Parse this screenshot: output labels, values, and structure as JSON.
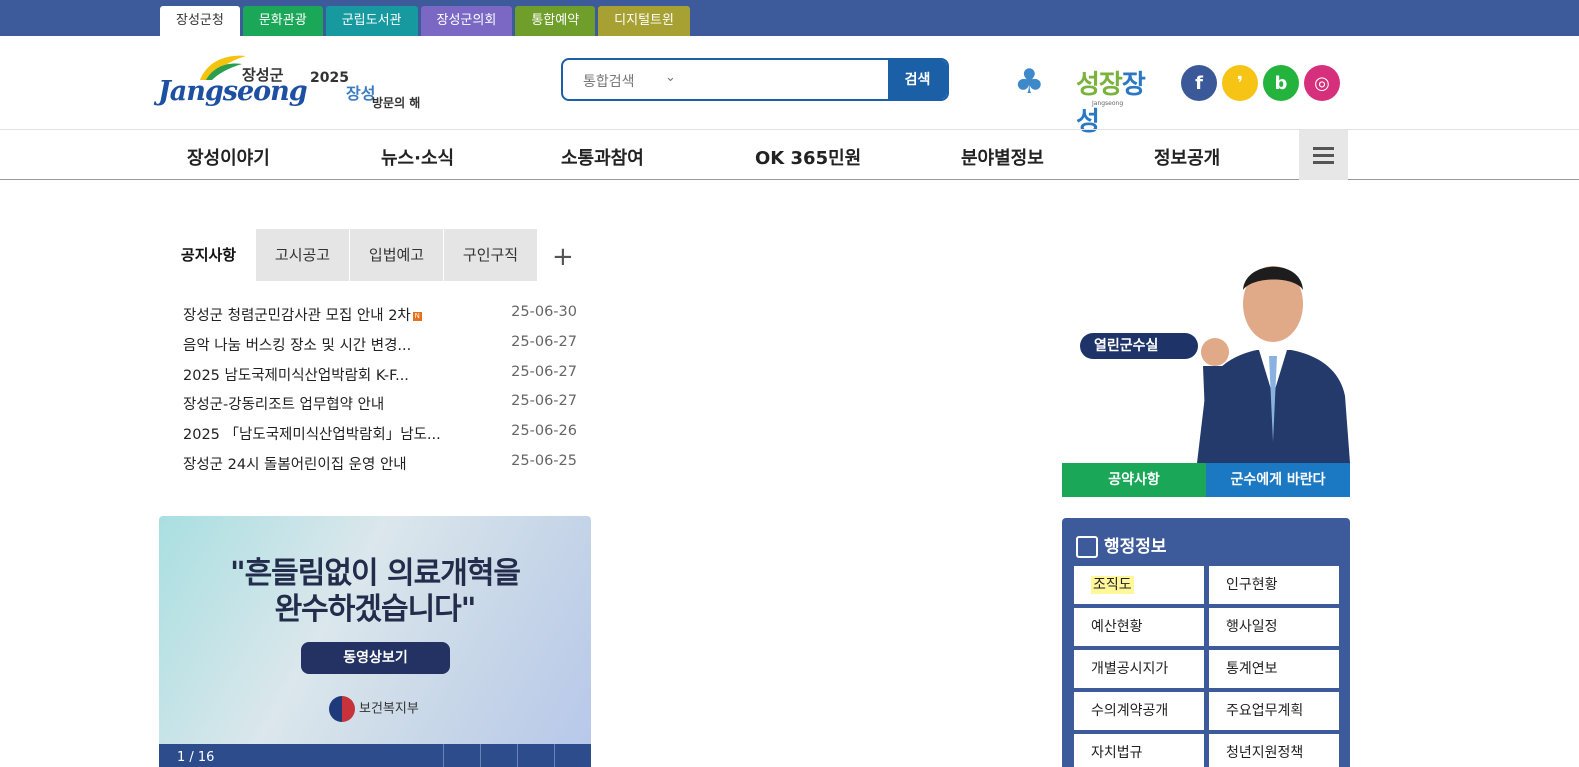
{
  "site_tabs": [
    {
      "label": "장성군청",
      "color": "#ffffff"
    },
    {
      "label": "문화관광",
      "color": "#1aa858"
    },
    {
      "label": "군립도서관",
      "color": "#169aa0"
    },
    {
      "label": "장성군의회",
      "color": "#7a68c4"
    },
    {
      "label": "통합예약",
      "color": "#6f9e2a"
    },
    {
      "label": "디지털트윈",
      "color": "#a7a133"
    }
  ],
  "header": {
    "logo_kor": "장성군",
    "logo_eng": "Jangseong",
    "visit_year": "2025",
    "visit_title": "장성",
    "visit_sub": "방문의 해",
    "search_select": "통합검색",
    "search_placeholder": "",
    "search_button": "검색",
    "brand_text_a": "성장",
    "brand_text_b": "장성",
    "brand_tiny": "Jangseong",
    "socials": [
      {
        "icon": "facebook-icon",
        "glyph": "f",
        "color": "#3b5998"
      },
      {
        "icon": "kakaostory-icon",
        "glyph": "❜",
        "color": "#f5c414"
      },
      {
        "icon": "blog-icon",
        "glyph": "b",
        "color": "#24b33d"
      },
      {
        "icon": "instagram-icon",
        "glyph": "◎",
        "color": "#d62f7c"
      }
    ]
  },
  "gnb": [
    "장성이야기",
    "뉴스·소식",
    "소통과참여",
    "OK 365민원",
    "분야별정보",
    "정보공개"
  ],
  "notice": {
    "tabs": [
      "공지사항",
      "고시공고",
      "입법예고",
      "구인구직"
    ],
    "more": "+",
    "items": [
      {
        "title": "장성군 청렴군민감사관 모집 안내 2차",
        "date": "25-06-30",
        "new": "N"
      },
      {
        "title": "음악 나눔 버스킹 장소 및 시간 변경...",
        "date": "25-06-27"
      },
      {
        "title": "2025 남도국제미식산업박람회 K-F...",
        "date": "25-06-27"
      },
      {
        "title": "장성군-강동리조트 업무협약 안내",
        "date": "25-06-27"
      },
      {
        "title": "2025 「남도국제미식산업박람회」남도...",
        "date": "25-06-26"
      },
      {
        "title": "장성군 24시 돌봄어린이집 운영 안내",
        "date": "25-06-25"
      }
    ]
  },
  "banner": {
    "quote_line1": "\"흔들림없이 의료개혁을",
    "quote_line2": "완수하겠습니다\"",
    "button": "동영상보기",
    "org": "보건복지부",
    "counter": "1 / 16"
  },
  "mayor": {
    "badge": "열린군수실",
    "btn_pledge": "공약사항",
    "btn_ask": "군수에게 바란다",
    "color_pledge": "#1aa858",
    "color_ask": "#1b78c2"
  },
  "admin": {
    "title": "행정정보",
    "items": [
      "조직도",
      "인구현황",
      "예산현황",
      "행사일정",
      "개별공시지가",
      "통계연보",
      "수의계약공개",
      "주요업무계획",
      "자치법규",
      "청년지원정책"
    ]
  }
}
